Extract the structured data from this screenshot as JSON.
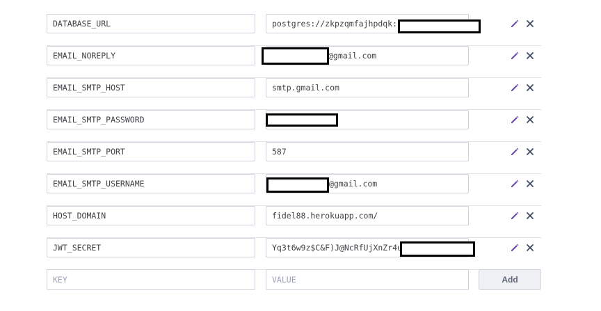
{
  "config_vars": [
    {
      "key": "DATABASE_URL",
      "value": "postgres://zkpzqmfajhpdqk:",
      "redacted": true
    },
    {
      "key": "EMAIL_NOREPLY",
      "value": "@gmail.com",
      "redacted": true
    },
    {
      "key": "EMAIL_SMTP_HOST",
      "value": "smtp.gmail.com",
      "redacted": false
    },
    {
      "key": "EMAIL_SMTP_PASSWORD",
      "value": "",
      "redacted": true
    },
    {
      "key": "EMAIL_SMTP_PORT",
      "value": "587",
      "redacted": false
    },
    {
      "key": "EMAIL_SMTP_USERNAME",
      "value": "@gmail.com",
      "redacted": true
    },
    {
      "key": "HOST_DOMAIN",
      "value": "fidel88.herokuapp.com/",
      "redacted": false
    },
    {
      "key": "JWT_SECRET",
      "value": "Yq3t6w9z$C&F)J@NcRfUjXnZr4u",
      "redacted": true
    }
  ],
  "new_var": {
    "key_placeholder": "KEY",
    "value_placeholder": "VALUE",
    "add_label": "Add"
  },
  "icons": {
    "edit": "pencil-icon",
    "delete": "close-icon"
  },
  "colors": {
    "icon": "#6b4aa8",
    "border": "#cfd2da",
    "text": "#3f3f44",
    "placeholder": "#9aa0b8"
  }
}
